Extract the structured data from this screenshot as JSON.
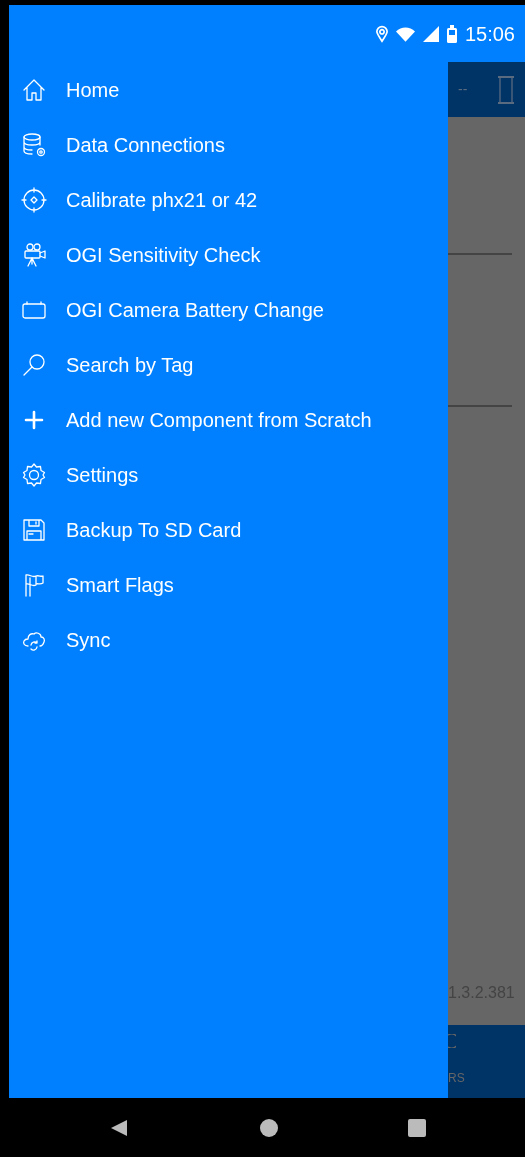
{
  "status_bar": {
    "time": "15:06"
  },
  "drawer": {
    "items": [
      {
        "label": "Home"
      },
      {
        "label": "Data Connections"
      },
      {
        "label": "Calibrate phx21 or 42"
      },
      {
        "label": "OGI Sensitivity Check"
      },
      {
        "label": "OGI Camera Battery Change"
      },
      {
        "label": "Search by Tag"
      },
      {
        "label": "Add new Component from Scratch"
      },
      {
        "label": "Settings"
      },
      {
        "label": "Backup To SD Card"
      },
      {
        "label": "Smart Flags"
      },
      {
        "label": "Sync"
      }
    ]
  },
  "background_app": {
    "header_text": "--",
    "version": "1.3.2.381",
    "bottom_tab_label": "RS"
  }
}
